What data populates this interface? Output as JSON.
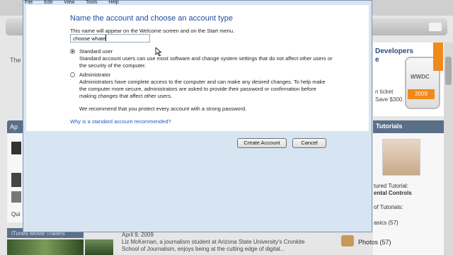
{
  "menubar": [
    "File",
    "Edit",
    "View",
    "Tools",
    "Help"
  ],
  "dialog": {
    "title": "Name the account and choose an account type",
    "subtitle": "This name will appear on the Welcome screen and on the Start menu.",
    "name_value": "choose whate",
    "standard": {
      "label": "Standard user",
      "desc1": "Standard account users can use most software and change system settings that do not affect other users or",
      "desc2": "the security of the computer.",
      "checked": true
    },
    "administrator": {
      "label": "Administrator",
      "desc1": "Administrators have complete access to the computer and can make any desired changes. To help make",
      "desc2": "the computer more secure, administrators are asked to provide their password or confirmation before",
      "desc3": "making changes that affect other users.",
      "checked": false
    },
    "recommend": "We recommend that you protect every account with a strong password.",
    "link": "Why is a standard account recommended?",
    "create_button": "Create Account",
    "cancel_button": "Cancel"
  },
  "background": {
    "left_text": "The",
    "left_panel_head": "Ap",
    "left_q": "Qui",
    "itunes_head": "iTunes Movie Trailers",
    "wwdc_title_1": "Developers",
    "wwdc_title_2": "e",
    "wwdc_sub_1": "n ticket",
    "wwdc_sub_2": "Save $300.",
    "wwdc_badge": "WWDC",
    "wwdc_year": "2009",
    "tutorials_head": "Tutorials",
    "tut_line1": "tured Tutorial:",
    "tut_line2": "ental Controls",
    "tut_line3": "of Tutorials:",
    "tut_line4": "asics",
    "tut_count": "(57)",
    "photos_label": "Photos",
    "photos_count": "(57)",
    "article_date": "April 9, 2009",
    "article_line1": "Liz McKernan, a journalism student at Arizona State University's Cronkite",
    "article_line2": "School of Journalism, enjoys being at the cutting edge of digital..."
  }
}
